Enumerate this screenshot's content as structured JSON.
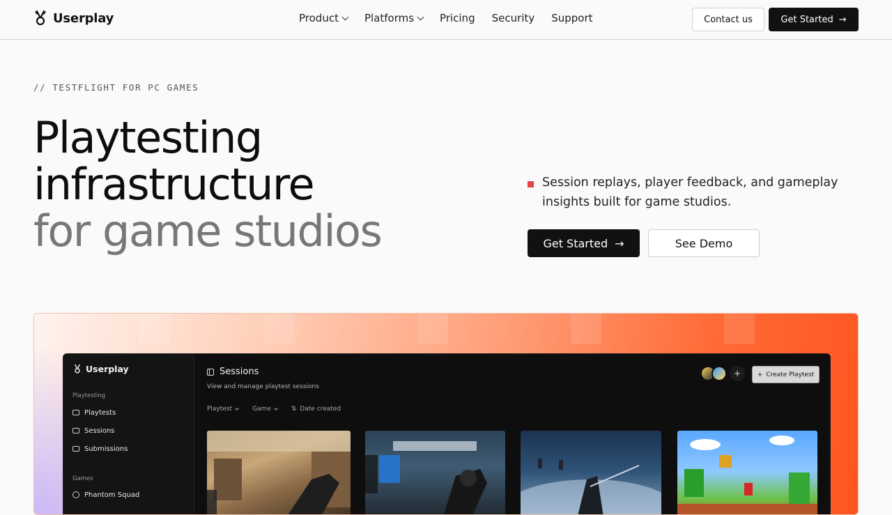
{
  "nav": {
    "brand": "Userplay",
    "links": [
      {
        "label": "Product",
        "dropdown": true
      },
      {
        "label": "Platforms",
        "dropdown": true
      },
      {
        "label": "Pricing",
        "dropdown": false
      },
      {
        "label": "Security",
        "dropdown": false
      },
      {
        "label": "Support",
        "dropdown": false
      }
    ],
    "contact_label": "Contact us",
    "get_started_label": "Get Started"
  },
  "hero": {
    "eyebrow": "// TESTFLIGHT FOR PC GAMES",
    "headline_line1": "Playtesting",
    "headline_line2": "infrastructure",
    "headline_line3": "for game studios",
    "description": "Session replays, player feedback, and gameplay insights built for game studios.",
    "primary_cta": "Get Started",
    "secondary_cta": "See Demo",
    "accent_color": "#e0474c"
  },
  "app_preview": {
    "brand": "Userplay",
    "sidebar": {
      "section_playtesting": "Playtesting",
      "items": [
        "Playtests",
        "Sessions",
        "Submissions"
      ],
      "section_games": "Games",
      "games": [
        "Phantom Squad"
      ]
    },
    "page_title": "Sessions",
    "page_subtitle": "View and manage playtest sessions",
    "filters": [
      "Playtest",
      "Game",
      "Date created"
    ],
    "create_button": "Create Playtest",
    "add_member": "+"
  }
}
